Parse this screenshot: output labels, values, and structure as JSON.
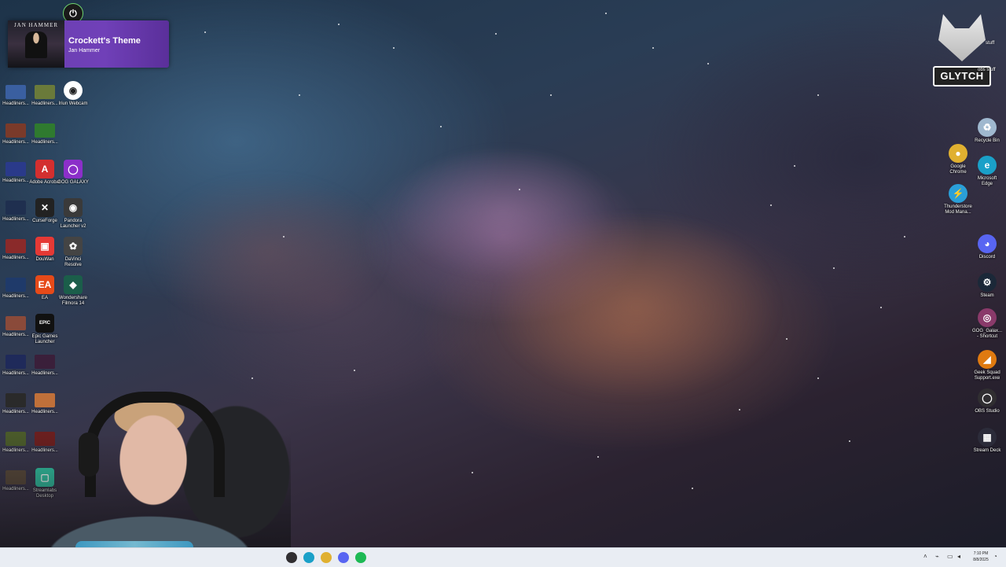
{
  "now_playing": {
    "title": "Crockett's Theme",
    "artist": "Jan Hammer",
    "album_text": "JAN HAMMER"
  },
  "desktop_icons_left": [
    {
      "label": "Headliners...",
      "kind": "thumb",
      "color": "#3a5fa0"
    },
    {
      "label": "Headliners...",
      "kind": "thumb",
      "color": "#6a7a3a"
    },
    {
      "label": "Headliners...",
      "kind": "thumb",
      "color": "#7a3a2a"
    },
    {
      "label": "Headliners...",
      "kind": "thumb",
      "color": "#2f7a2f"
    },
    {
      "label": "Headliners...",
      "kind": "thumb",
      "color": "#2a3a8a"
    },
    {
      "label": "Adobe Acrobat",
      "kind": "app",
      "color": "#d32f2f",
      "glyph": "A"
    },
    {
      "label": "GOG GALAXY",
      "kind": "app",
      "color": "#8b2fc9",
      "glyph": "◯"
    },
    {
      "label": "Headliners...",
      "kind": "thumb",
      "color": "#1f2f4f"
    },
    {
      "label": "CurseForge",
      "kind": "app",
      "color": "#222222",
      "glyph": "✕"
    },
    {
      "label": "Pandora Launcher v2",
      "kind": "app",
      "color": "#3a3a3a",
      "glyph": "◉"
    },
    {
      "label": "Headliners...",
      "kind": "thumb",
      "color": "#8a2a2a"
    },
    {
      "label": "DouWan",
      "kind": "app",
      "color": "#e53935",
      "glyph": "▣"
    },
    {
      "label": "DaVinci Resolve",
      "kind": "app",
      "color": "#444444",
      "glyph": "✿"
    },
    {
      "label": "Headliners...",
      "kind": "thumb",
      "color": "#1f3a6a"
    },
    {
      "label": "EA",
      "kind": "app",
      "color": "#e64a19",
      "glyph": "EA"
    },
    {
      "label": "Wondershare Filmora 14",
      "kind": "app",
      "color": "#1b5e4a",
      "glyph": "◆"
    },
    {
      "label": "Headliners...",
      "kind": "thumb",
      "color": "#8a4a3a"
    },
    {
      "label": "Epic Games Launcher",
      "kind": "app",
      "color": "#111111",
      "glyph": "EPIC"
    },
    {
      "label": "Headliners...",
      "kind": "thumb",
      "color": "#1f2a5a"
    },
    {
      "label": "Headliners...",
      "kind": "thumb",
      "color": "#3a1f3a"
    },
    {
      "label": "Headliners...",
      "kind": "thumb",
      "color": "#2a2a2a"
    },
    {
      "label": "Headliners...",
      "kind": "thumb",
      "color": "#c0703a"
    },
    {
      "label": "Headliners...",
      "kind": "thumb",
      "color": "#4a5a2a"
    },
    {
      "label": "Headliners...",
      "kind": "thumb",
      "color": "#6a1f1f"
    },
    {
      "label": "Headliners...",
      "kind": "thumb",
      "color": "#5a4a3a"
    },
    {
      "label": "Streamlabs Desktop",
      "kind": "app",
      "color": "#31c3a2",
      "glyph": "▢"
    }
  ],
  "webcam_icon": {
    "label": "Iriun Webcam"
  },
  "glytch_logo": {
    "text": "GLYTCH"
  },
  "top_right_labels": [
    "stuff",
    "obs stuff"
  ],
  "desktop_icons_right": [
    {
      "label": "Recycle Bin",
      "color": "#9fb8cf",
      "glyph": "♻"
    },
    {
      "label": "Google Chrome",
      "color": "#e0b030",
      "glyph": "●"
    },
    {
      "label": "Microsoft Edge",
      "color": "#1aa0c8",
      "glyph": "e"
    },
    {
      "label": "Thunderstore Mod Mana...",
      "color": "#2a9fd8",
      "glyph": "⚡"
    },
    {
      "label": "Discord",
      "color": "#5865f2",
      "glyph": "◕"
    },
    {
      "label": "Steam",
      "color": "#1b2838",
      "glyph": "⚙"
    },
    {
      "label": "GOG_Galax... - Shortcut",
      "color": "#8a3a6a",
      "glyph": "◎"
    },
    {
      "label": "Geek Squad Support.exe",
      "color": "#e07a10",
      "glyph": "◢"
    },
    {
      "label": "OBS Studio",
      "color": "#302e31",
      "glyph": "◯"
    },
    {
      "label": "Stream Deck",
      "color": "#2c2c3a",
      "glyph": "▦"
    }
  ],
  "taskbar": {
    "apps": [
      {
        "name": "obs",
        "color": "#302e31"
      },
      {
        "name": "edge",
        "color": "#1aa0c8"
      },
      {
        "name": "chrome",
        "color": "#e0b030"
      },
      {
        "name": "discord",
        "color": "#5865f2"
      },
      {
        "name": "spotify",
        "color": "#1db954"
      }
    ],
    "time": "7:10 PM",
    "date": "8/8/2025"
  }
}
